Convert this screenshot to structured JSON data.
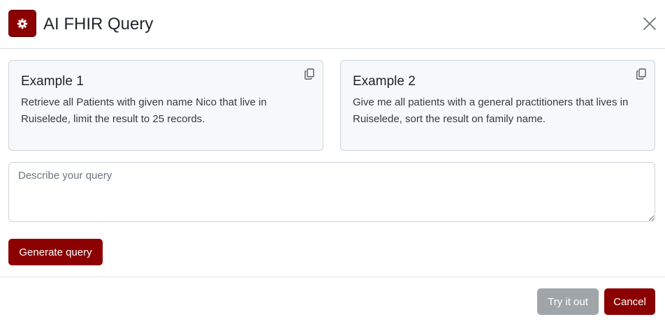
{
  "dialog": {
    "title": "AI FHIR Query",
    "icon": "gear-icon",
    "close_icon": "close-icon"
  },
  "examples": [
    {
      "title": "Example 1",
      "text": "Retrieve all Patients with given name Nico that live in Ruiselede, limit the result to 25 records.",
      "icon": "copy-icon"
    },
    {
      "title": "Example 2",
      "text": "Give me all patients with a general practitioners that lives in Ruiselede, sort the result on family name.",
      "icon": "copy-icon"
    }
  ],
  "query": {
    "placeholder": "Describe your query",
    "value": ""
  },
  "buttons": {
    "generate": "Generate query",
    "try": "Try it out",
    "cancel": "Cancel"
  },
  "colors": {
    "accent": "#8b0000",
    "disabled": "#a0a5aa"
  }
}
